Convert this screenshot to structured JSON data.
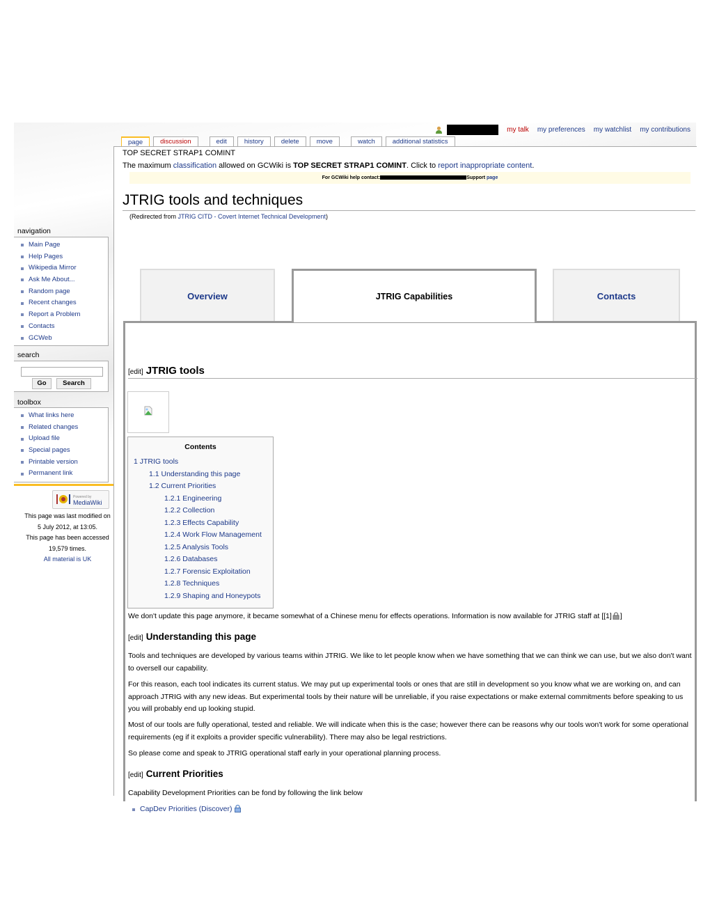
{
  "personal_bar": {
    "user_icon": "user-icon",
    "username_redacted": true,
    "items": [
      {
        "label": "my talk",
        "color": "#ba0000"
      },
      {
        "label": "my preferences",
        "color": "#1e3a8a"
      },
      {
        "label": "my watchlist",
        "color": "#1e3a8a"
      },
      {
        "label": "my contributions",
        "color": "#1e3a8a"
      }
    ]
  },
  "content_actions": [
    {
      "label": "page",
      "selected": true
    },
    {
      "label": "discussion",
      "color": "#ba0000"
    },
    {
      "label": "edit"
    },
    {
      "label": "history"
    },
    {
      "label": "delete"
    },
    {
      "label": "move"
    },
    {
      "label": "watch"
    },
    {
      "label": "additional statistics"
    }
  ],
  "classification_banner": "TOP SECRET STRAP1 COMINT",
  "classification_notice": {
    "prefix": "The maximum ",
    "link1": "classification",
    "middle": " allowed on GCWiki is ",
    "level": "TOP SECRET STRAP1 COMINT",
    "suffix": ". Click to ",
    "link2": "report inappropriate content",
    "end": "."
  },
  "help_bar": {
    "prefix": "For GCWiki help contact:",
    "middle": "Support ",
    "link": "page"
  },
  "page_title": "JTRIG tools and techniques",
  "redirect": {
    "prefix": "(Redirected from ",
    "link": "JTRIG CITD - Covert Internet Technical Development",
    "suffix": ")"
  },
  "big_tabs": [
    {
      "label": "Overview",
      "selected": false
    },
    {
      "label": "JTRIG Capabilities",
      "selected": true
    },
    {
      "label": "Contacts",
      "selected": false
    }
  ],
  "sections": {
    "edit_label": "[edit]",
    "jtrig_tools": "JTRIG tools",
    "understanding": "Understanding this page",
    "current_priorities": "Current Priorities"
  },
  "toc": {
    "title": "Contents",
    "items": [
      {
        "level": 1,
        "label": "1 JTRIG tools"
      },
      {
        "level": 2,
        "label": "1.1 Understanding this page"
      },
      {
        "level": 2,
        "label": "1.2 Current Priorities"
      },
      {
        "level": 3,
        "label": "1.2.1 Engineering"
      },
      {
        "level": 3,
        "label": "1.2.2 Collection"
      },
      {
        "level": 3,
        "label": "1.2.3 Effects Capability"
      },
      {
        "level": 3,
        "label": "1.2.4 Work Flow Management"
      },
      {
        "level": 3,
        "label": "1.2.5 Analysis Tools"
      },
      {
        "level": 3,
        "label": "1.2.6 Databases"
      },
      {
        "level": 3,
        "label": "1.2.7 Forensic Exploitation"
      },
      {
        "level": 3,
        "label": "1.2.8 Techniques"
      },
      {
        "level": 3,
        "label": "1.2.9 Shaping and Honeypots"
      }
    ]
  },
  "body": {
    "notice": "We don't update this page anymore, it became somewhat of a Chinese menu for effects operations. Information is now available for JTRIG staff at [[1]",
    "notice_end": "]",
    "p1": "Tools and techniques are developed by various teams within JTRIG. We like to let people know when we have something that we can think we can use, but we also don't want to oversell our capability.",
    "p2": "For this reason, each tool indicates its current status. We may put up experimental tools or ones that are still in development so you know what we are working on, and can approach JTRIG with any new ideas. But experimental tools by their nature will be unreliable, if you raise expectations or make external commitments before speaking to us you will probably end up looking stupid.",
    "p3": "Most of our tools are fully operational, tested and reliable. We will indicate when this is the case; however there can be reasons why our tools won't work for some operational requirements (eg if it exploits a provider specific vulnerability). There may also be legal restrictions.",
    "p4": "So please come and speak to JTRIG operational staff early in your operational planning process.",
    "p5": "Capability Development Priorities can be fond by following the link below",
    "link_capdev": "CapDev Priorities (Discover)"
  },
  "sidebar": {
    "navigation_title": "navigation",
    "navigation": [
      "Main Page",
      "Help Pages",
      "Wikipedia Mirror",
      "Ask Me About...",
      "Random page",
      "Recent changes",
      "Report a Problem",
      "Contacts",
      "GCWeb"
    ],
    "search_title": "search",
    "search_value": "",
    "go_label": "Go",
    "search_label": "Search",
    "toolbox_title": "toolbox",
    "toolbox": [
      "What links here",
      "Related changes",
      "Upload file",
      "Special pages",
      "Printable version",
      "Permanent link"
    ],
    "powered_by": "Powered by",
    "mediawiki": "MediaWiki",
    "last_modified": "This page was last modified on 5 July 2012, at 13:05.",
    "accessed": "This page has been accessed 19,579 times.",
    "material": "All material is UK"
  }
}
